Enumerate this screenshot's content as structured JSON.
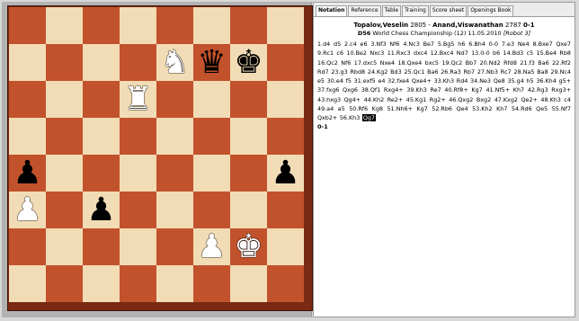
{
  "tabs": [
    "Notation",
    "Reference",
    "Table",
    "Training",
    "Score sheet",
    "Openings Book"
  ],
  "active_tab": "Notation",
  "game": {
    "white": "Topalov,Veselin",
    "white_elo": "2805",
    "black": "Anand,Viswanathan",
    "black_elo": "2787",
    "result": "0-1",
    "eco": "D56",
    "event": "World Chess Championship (12) 11.05.2010",
    "round": "[Robot 3]"
  },
  "moves_text": "1.d4 d5 2.c4 e6 3.Nf3 Nf6 4.Nc3 Be7 5.Bg5 h6 6.Bh4 0-0 7.e3 Ne4 8.Bxe7 Qxe7 9.Rc1 c6 10.Be2 Nxc3 11.Rxc3 dxc4 12.Bxc4 Nd7 13.0-0 b6 14.Bd3 c5 15.Be4 Rb8 16.Qc2 Nf6 17.dxc5 Nxe4 18.Qxe4 bxc5 19.Qc2 Bb7 20.Nd2 Rfd8 21.f3 Ba6 22.Rf2 Rd7 23.g3 Rbd8 24.Kg2 Bd3 25.Qc1 Ba6 26.Ra3 Rb7 27.Nb3 Rc7 28.Na5 Ba8 29.Nc4 e5 30.e4 f5 31.exf5 e4 32.fxe4 Qxe4+ 33.Kh3 Rd4 34.Ne3 Qe8 35.g4 h5 36.Kh4 g5+ 37.fxg6 Qxg6 38.Qf1 Rxg4+ 39.Kh3 Re7 40.Rf8+ Kg7 41.Nf5+ Kh7 42.Rg3 Rxg3+ 43.hxg3 Qg4+ 44.Kh2 Re2+ 45.Kg1 Rg2+ 46.Qxg2 Bxg2 47.Kxg2 Qe2+ 48.Kh3 c4 49.a4 a5 50.Rf6 Kg8 51.Nh6+ Kg7 52.Rb6 Qe4 53.Kh2 Kh7 54.Rd6 Qe5 55.Nf7 Qxb2+ 56.Kh3",
  "current_move": "Qg7",
  "result_line": "0-1",
  "board": {
    "orientation": "white",
    "pieces": [
      {
        "square": "e7",
        "piece": "knight",
        "color": "white",
        "glyph": "♞"
      },
      {
        "square": "f7",
        "piece": "queen",
        "color": "black",
        "glyph": "♛"
      },
      {
        "square": "g7",
        "piece": "king",
        "color": "black",
        "glyph": "♚"
      },
      {
        "square": "d6",
        "piece": "rook",
        "color": "white",
        "glyph": "♜"
      },
      {
        "square": "a4",
        "piece": "pawn",
        "color": "black",
        "glyph": "♟"
      },
      {
        "square": "h4",
        "piece": "pawn",
        "color": "black",
        "glyph": "♟"
      },
      {
        "square": "a3",
        "piece": "pawn",
        "color": "white",
        "glyph": "♟"
      },
      {
        "square": "c3",
        "piece": "pawn",
        "color": "black",
        "glyph": "♟"
      },
      {
        "square": "f2",
        "piece": "pawn",
        "color": "white",
        "glyph": "♟"
      },
      {
        "square": "g2",
        "piece": "king",
        "color": "white",
        "glyph": "♚"
      }
    ]
  },
  "colors": {
    "light_square": "#f2dcb6",
    "dark_square": "#c2522b",
    "border": "#7a2a12",
    "highlight_bg": "#000000",
    "highlight_fg": "#ffffff"
  }
}
